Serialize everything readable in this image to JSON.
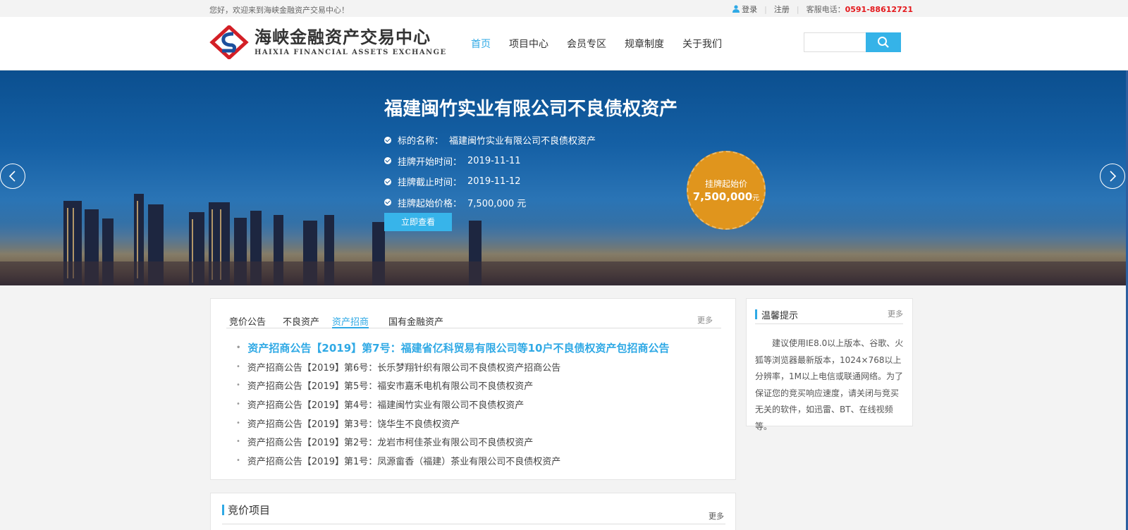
{
  "topbar": {
    "welcome": "您好，欢迎来到海峡金融资产交易中心！",
    "login": "登录",
    "register": "注册",
    "phone_label": "客服电话：",
    "phone": "0591-88612721"
  },
  "logo": {
    "cn": "海峡金融资产交易中心",
    "en": "HAIXIA FINANCIAL ASSETS EXCHANGE"
  },
  "nav": {
    "items": [
      {
        "label": "首页",
        "active": true
      },
      {
        "label": "项目中心"
      },
      {
        "label": "会员专区"
      },
      {
        "label": "规章制度"
      },
      {
        "label": "关于我们"
      }
    ]
  },
  "search": {
    "placeholder": ""
  },
  "banner": {
    "title": "福建闽竹实业有限公司不良债权资产",
    "details": [
      {
        "key": "标的名称：",
        "value": "福建闽竹实业有限公司不良债权资产"
      },
      {
        "key": "挂牌开始时间：",
        "value": "2019-11-11"
      },
      {
        "key": "挂牌截止时间：",
        "value": "2019-11-12"
      },
      {
        "key": "挂牌起始价格：",
        "value": "7,500,000 元"
      }
    ],
    "view_button": "立即查看",
    "price_label": "挂牌起始价",
    "price_value": "7,500,000",
    "price_unit": "元"
  },
  "main_panel": {
    "tabs": [
      {
        "label": "竞价公告"
      },
      {
        "label": "不良资产"
      },
      {
        "label": "资产招商",
        "active": true
      },
      {
        "label": "国有金融资产"
      }
    ],
    "more": "更多",
    "items": [
      "资产招商公告【2019】第7号：福建省亿科贸易有限公司等10户不良债权资产包招商公告",
      "资产招商公告【2019】第6号：长乐梦翔针织有限公司不良债权资产招商公告",
      "资产招商公告【2019】第5号：福安市嘉禾电机有限公司不良债权资产",
      "资产招商公告【2019】第4号：福建闽竹实业有限公司不良债权资产",
      "资产招商公告【2019】第3号：饶华生不良债权资产",
      "资产招商公告【2019】第2号：龙岩市柯佳茶业有限公司不良债权资产",
      "资产招商公告【2019】第1号：凤源畲香（福建）茶业有限公司不良债权资产"
    ]
  },
  "tips": {
    "title": "温馨提示",
    "more": "更多",
    "body": "建议使用IE8.0以上版本、谷歌、火狐等浏览器最新版本，1024×768以上分辨率，1M以上电信或联通网络。为了保证您的竞买响应速度，请关闭与竞买无关的软件，如迅雷、BT、在线视频等。"
  },
  "bid_section": {
    "title": "竞价项目",
    "more": "更多"
  },
  "colors": {
    "accent": "#2fa9e5",
    "phone": "#e4181c",
    "price_badge": "#e0951d",
    "banner_top": "#0b4f8f"
  },
  "icons": [
    "user-icon",
    "search-icon",
    "check-icon",
    "arrow-left-icon",
    "arrow-right-icon"
  ]
}
